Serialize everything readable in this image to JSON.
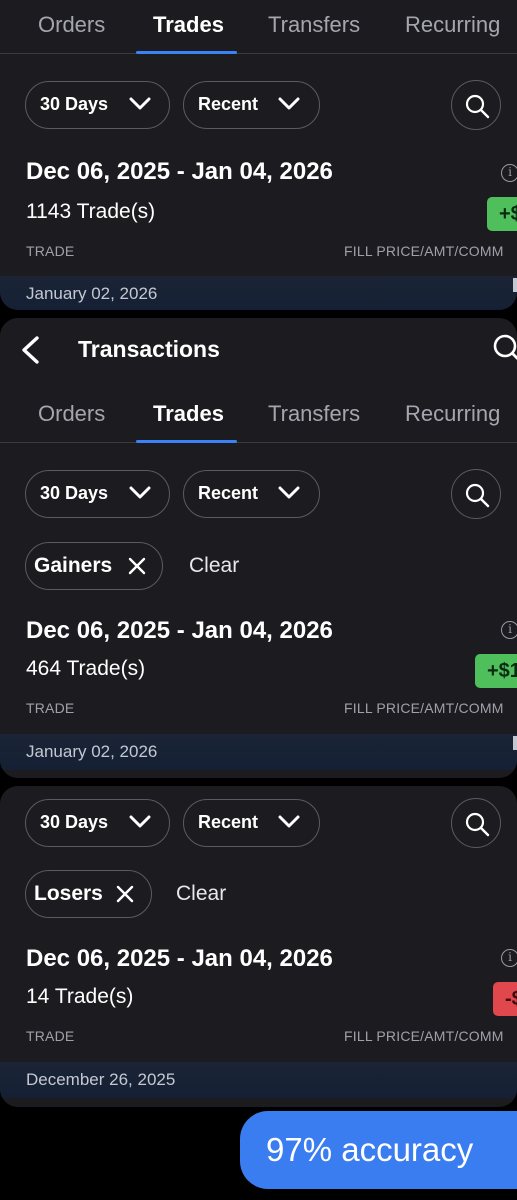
{
  "header": {
    "title": "Transactions"
  },
  "tabs": [
    "Orders",
    "Trades",
    "Transfers",
    "Recurring"
  ],
  "active_tab": "Trades",
  "filters": {
    "period": "30 Days",
    "sort": "Recent"
  },
  "panels": [
    {
      "date_range": "Dec 06, 2025 - Jan 04, 2026",
      "trade_count": "1143 Trade(s)",
      "badge": "+$",
      "col_trade": "TRADE",
      "col_fill": "FILL PRICE/AMT/COMM",
      "group_date": "January 02, 2026"
    },
    {
      "chip": "Gainers",
      "clear": "Clear",
      "date_range": "Dec 06, 2025 - Jan 04, 2026",
      "trade_count": "464 Trade(s)",
      "badge": "+$1",
      "col_trade": "TRADE",
      "col_fill": "FILL PRICE/AMT/COMM",
      "group_date": "January 02, 2026"
    },
    {
      "chip": "Losers",
      "clear": "Clear",
      "date_range": "Dec 06, 2025 - Jan 04, 2026",
      "trade_count": "14 Trade(s)",
      "badge": "-$",
      "col_trade": "TRADE",
      "col_fill": "FILL PRICE/AMT/COMM",
      "group_date": "December 26, 2025"
    }
  ],
  "accuracy_label": "97% accuracy",
  "colors": {
    "accent": "#3b82f6",
    "gain": "#4fbf5b",
    "loss": "#e0484d",
    "background": "#1c1c20"
  }
}
